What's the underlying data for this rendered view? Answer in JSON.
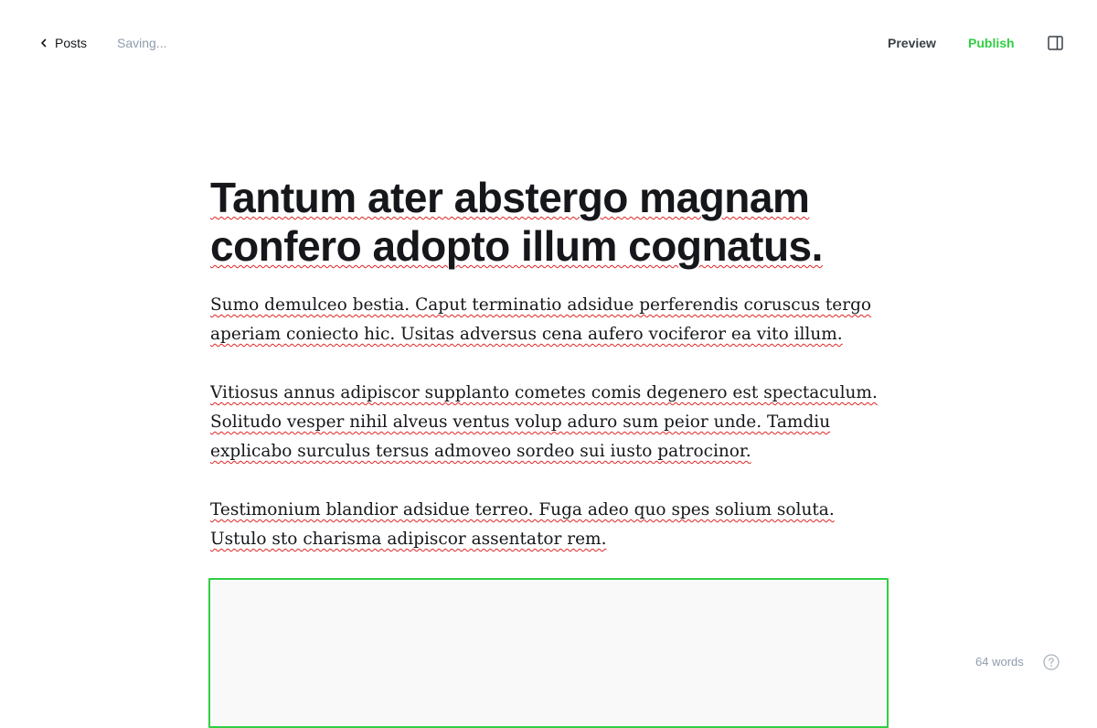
{
  "header": {
    "back_label": "Posts",
    "status": "Saving...",
    "preview_label": "Preview",
    "publish_label": "Publish"
  },
  "post": {
    "title": "Tantum ater abstergo magnam confero adopto illum cognatus.",
    "paragraphs": [
      "Sumo demulceo bestia. Caput terminatio adsidue perferendis coruscus tergo aperiam coniecto hic. Usitas adversus cena aufero vociferor ea vito illum.",
      "Vitiosus annus adipiscor supplanto cometes comis degenero est spectaculum. Solitudo vesper nihil alveus ventus volup aduro sum peior unde. Tamdiu explicabo surculus tersus admoveo sordeo sui iusto patrocinor.",
      "Testimonium blandior adsidue terreo. Fuga adeo quo spes solium soluta. Ustulo sto charisma adipiscor assentator rem."
    ]
  },
  "footer": {
    "word_count": "64 words"
  },
  "colors": {
    "accent": "#30cf43",
    "muted": "#8e9cac",
    "text": "#15171a",
    "spellcheck": "#e02424"
  },
  "icons": {
    "back": "chevron-left-icon",
    "sidebar": "sidebar-toggle-icon",
    "help": "question-circle-icon"
  }
}
